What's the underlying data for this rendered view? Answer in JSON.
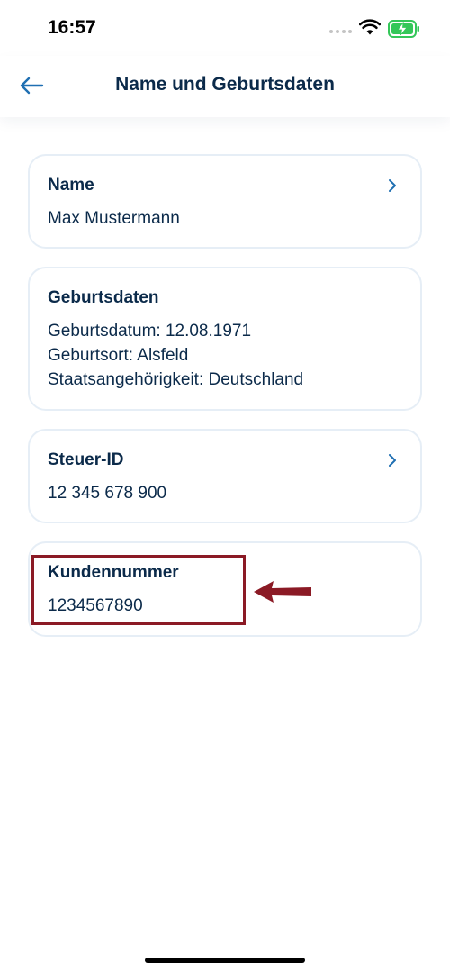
{
  "status_bar": {
    "time": "16:57"
  },
  "header": {
    "title": "Name und Geburtsdaten"
  },
  "cards": {
    "name": {
      "title": "Name",
      "value": "Max Mustermann"
    },
    "birth": {
      "title": "Geburtsdaten",
      "date": "Geburtsdatum: 12.08.1971",
      "place": "Geburtsort: Alsfeld",
      "nationality": "Staatsangehörigkeit: Deutschland"
    },
    "tax": {
      "title": "Steuer-ID",
      "value": "12 345 678 900"
    },
    "customer": {
      "title": "Kundennummer",
      "value": "1234567890"
    }
  },
  "colors": {
    "text": "#0b2a4a",
    "accent": "#1f6fb2",
    "card_border": "#e6eef6",
    "annotation": "#8b1a25",
    "battery": "#34c759"
  }
}
